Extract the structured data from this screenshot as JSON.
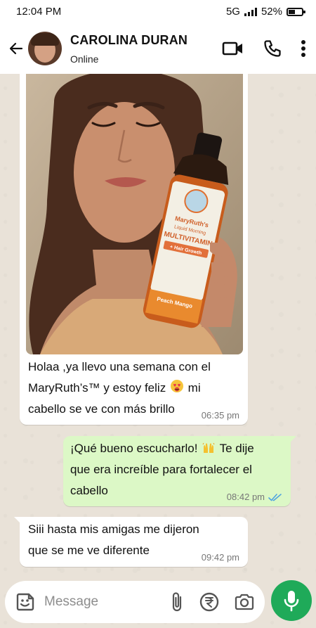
{
  "status_bar": {
    "time": "12:04 PM",
    "network": "5G",
    "battery_percent": "52%",
    "battery_level": 0.52
  },
  "header": {
    "contact_name": "CAROLINA DURAN",
    "contact_status": "Online"
  },
  "messages": [
    {
      "direction": "incoming",
      "has_image": true,
      "image": {
        "brand": "MaryRuth's",
        "subtitle": "Liquid Morning",
        "product": "MULTIVITAMIN",
        "badge": "+ Hair Growth",
        "flavor": "Peach Mango"
      },
      "line1": "Holaa ,ya llevo una semana con el",
      "line2a": "MaryRuth’s™ y estoy feliz",
      "line2b": "mi",
      "line3": "cabello se ve con más brillo",
      "time": "06:35 pm"
    },
    {
      "direction": "outgoing",
      "line1a": "¡Qué bueno escucharlo!",
      "line1b": "Te dije",
      "line2": "que era increíble para fortalecer el",
      "line3": "cabello",
      "time": "08:42 pm",
      "read": true
    },
    {
      "direction": "incoming",
      "line1": "Siii  hasta mis amigas me dijeron",
      "line2": "que se me ve diferente",
      "time": "09:42 pm"
    }
  ],
  "composer": {
    "placeholder": "Message"
  },
  "colors": {
    "outgoing_bubble": "#dcf8c6",
    "mic_button": "#1faa59",
    "read_tick": "#4fa3e0"
  }
}
